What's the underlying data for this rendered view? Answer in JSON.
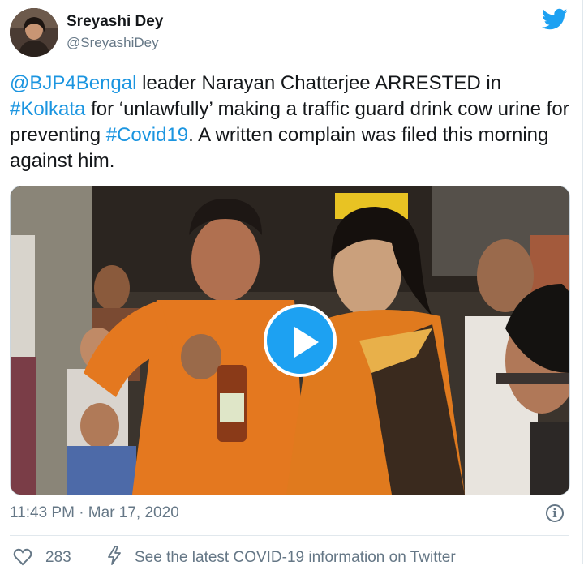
{
  "author": {
    "name": "Sreyashi Dey",
    "handle": "@SreyashiDey"
  },
  "tweet": {
    "segments": [
      {
        "text": "@BJP4Bengal",
        "link": true
      },
      {
        "text": " leader Narayan Chatterjee ARRESTED in ",
        "link": false
      },
      {
        "text": "#Kolkata",
        "link": true
      },
      {
        "text": " for ‘unlawfully’ making a traffic guard drink cow urine for preventing ",
        "link": false
      },
      {
        "text": "#Covid19",
        "link": true
      },
      {
        "text": ". A written complain was filed this morning against him.",
        "link": false
      }
    ]
  },
  "media": {
    "type": "video",
    "play_icon": "play-icon"
  },
  "footer": {
    "timestamp": "11:43 PM · Mar 17, 2020",
    "info_icon": "i",
    "likes": "283",
    "covid_notice": "See the latest COVID-19 information on Twitter"
  },
  "colors": {
    "link": "#1b95e0",
    "twitter_blue": "#1da1f2",
    "muted": "#657786",
    "text": "#14171a"
  },
  "icons": [
    "twitter-bird-icon",
    "play-icon",
    "info-icon",
    "heart-icon",
    "lightning-bolt-icon"
  ]
}
